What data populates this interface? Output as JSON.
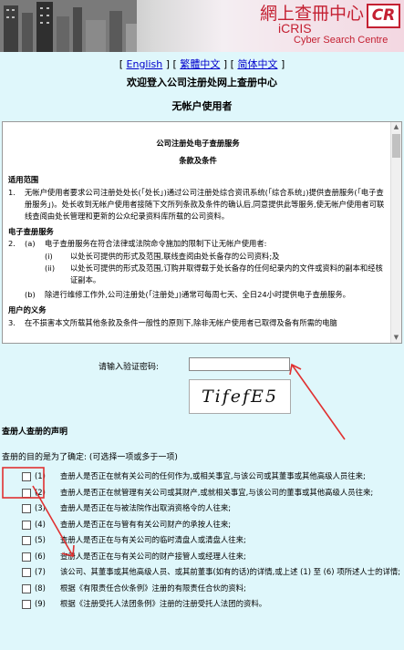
{
  "header": {
    "brand_cn": "網上查冊中心",
    "brand_cr": "CR",
    "brand_iris": "iCRIS",
    "brand_sub": "Cyber Search Centre"
  },
  "languages": {
    "open": "[",
    "english": "English",
    "sep1": "] [",
    "traditional": "繁體中文",
    "sep2": "] [",
    "simplified": "简体中文",
    "close": "]"
  },
  "page": {
    "title": "欢迎登入公司注册处网上查册中心",
    "subtitle": "无帐户使用者"
  },
  "terms": {
    "heading": "公司注册处电子查册服务",
    "subheading": "条款及条件",
    "scope_title": "适用范围",
    "clause1_num": "1.",
    "clause1": "无帐户使用者要求公司注册处处长(「处长」)通过公司注册处综合资讯系统(「综合系统」)提供查册服务(「电子查册服务」)。处长收到无帐户使用者接随下文所列条款及条件的确认后,同意提供此等服务,使无帐户使用者可联线查阅由处长管理和更新的公众纪录资料库所载的公司资料。",
    "service_title": "电子查册服务",
    "clause2_num": "2.",
    "clause2a_label": "(a)",
    "clause2a": "电子查册服务在符合法律或法院命令施加的限制下让无帐户使用者:",
    "clause2a_i_label": "(i)",
    "clause2a_i": "以处长可提供的形式及范围,联线查阅由处长备存的公司资料;及",
    "clause2a_ii_label": "(ii)",
    "clause2a_ii": "以处长可提供的形式及范围,订购并取得载于处长备存的任何纪录内的文件或资料的副本和经核证副本。",
    "clause2b_label": "(b)",
    "clause2b": "除进行维修工作外,公司注册处(「注册处」)通常可每周七天、全日24小时提供电子查册服务。",
    "duty_title": "用户的义务",
    "clause3_num": "3.",
    "clause3": "在不损害本文所载其他条款及条件一般性的原则下,除非无帐户使用者已取得及备有所需的电脑"
  },
  "scrollbar": {
    "up_icon": "▲",
    "down_icon": "▼"
  },
  "captcha": {
    "label": "请输入验证密码:",
    "value": "",
    "image_text": "TifefE5"
  },
  "declaration": {
    "heading": "查册人查册的声明",
    "intro": "查册的目的是为了确定: (可选择一项或多于一项)",
    "items": [
      {
        "num": "(1)",
        "text": "查册人是否正在就有关公司的任何作为,或相关事宜,与该公司或其董事或其他高级人员往来;"
      },
      {
        "num": "(2)",
        "text": "查册人是否正在就管理有关公司或其财产,或就相关事宜,与该公司的董事或其他高级人员往来;"
      },
      {
        "num": "(3)",
        "text": "查册人是否正在与被法院作出取消资格令的人往来;"
      },
      {
        "num": "(4)",
        "text": "查册人是否正在与管有有关公司财产的承按人往来;"
      },
      {
        "num": "(5)",
        "text": "查册人是否正在与有关公司的临时清盘人或清盘人往来;"
      },
      {
        "num": "(6)",
        "text": "查册人是否正在与有关公司的财产接管人或经理人往来;"
      },
      {
        "num": "(7)",
        "text": "该公司、其董事或其他高级人员、或其前董事(如有的话)的详情,或上述 (1) 至 (6) 项所述人士的详情;"
      },
      {
        "num": "(8)",
        "text": "根据《有限责任合伙条例》注册的有限责任合伙的资料;"
      },
      {
        "num": "(9)",
        "text": "根据《注册受托人法团条例》注册的注册受托人法团的资料。"
      }
    ]
  },
  "annotation": {
    "color": "#e03131"
  }
}
